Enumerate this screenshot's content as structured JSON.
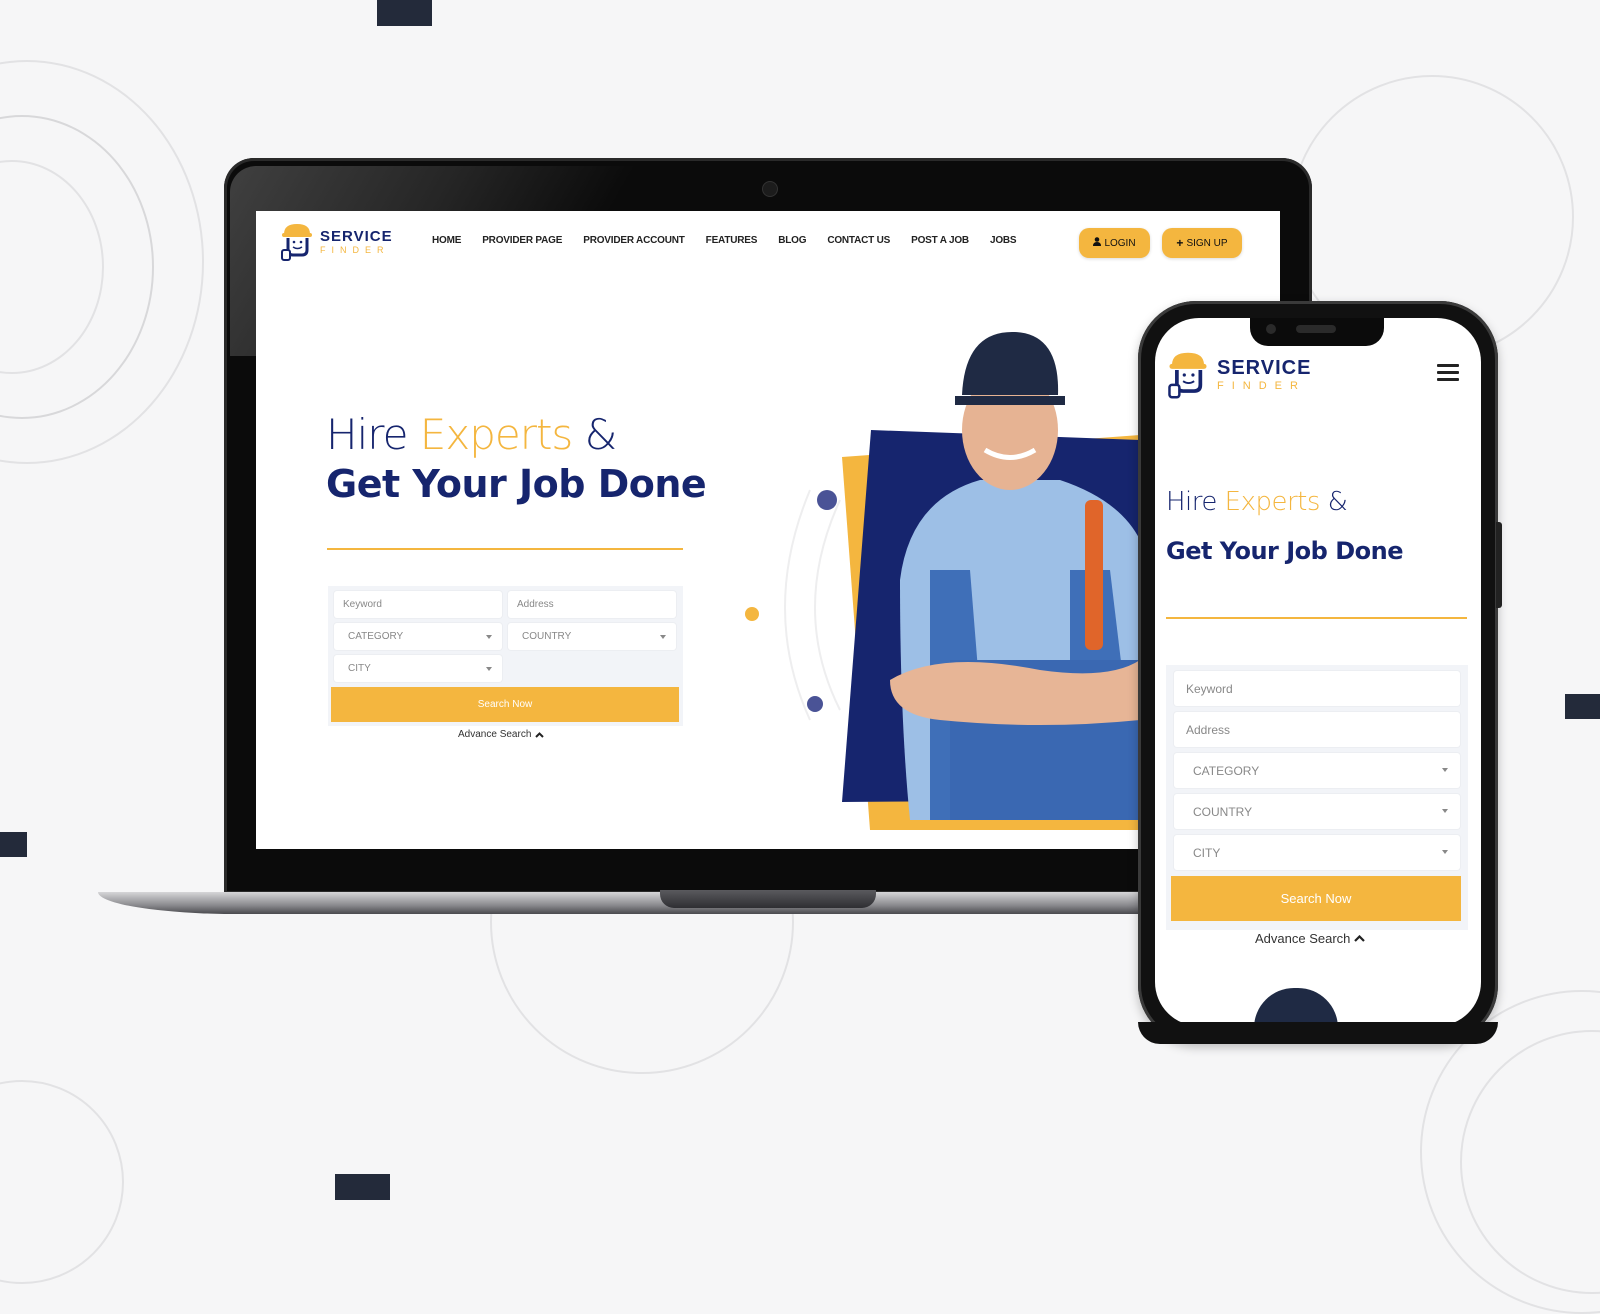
{
  "brand": {
    "name_line1": "SERVICE",
    "name_line2": "FINDER",
    "colors": {
      "navy": "#16256e",
      "yellow": "#f4b63f",
      "dark": "#232a3a"
    }
  },
  "desktop": {
    "nav": [
      "HOME",
      "PROVIDER PAGE",
      "PROVIDER ACCOUNT",
      "FEATURES",
      "BLOG",
      "CONTACT US",
      "POST A JOB",
      "JOBS"
    ],
    "login_label": "LOGIN",
    "signup_label": "SIGN UP",
    "hero": {
      "line1_part1": "Hire",
      "line1_accent": "Experts",
      "line1_part2": "&",
      "line2": "Get Your Job Done"
    },
    "form": {
      "keyword_placeholder": "Keyword",
      "address_placeholder": "Address",
      "category": "CATEGORY",
      "country": "COUNTRY",
      "city": "CITY",
      "search_button": "Search Now",
      "advance_search": "Advance Search"
    }
  },
  "mobile": {
    "hero": {
      "line1_part1": "Hire",
      "line1_accent": "Experts",
      "line1_part2": "&",
      "line2": "Get Your Job Done"
    },
    "form": {
      "keyword_placeholder": "Keyword",
      "address_placeholder": "Address",
      "category": "CATEGORY",
      "country": "COUNTRY",
      "city": "CITY",
      "search_button": "Search Now",
      "advance_search": "Advance Search"
    }
  },
  "icons": {
    "user": "user-icon",
    "plus": "plus-icon",
    "menu": "hamburger-menu-icon",
    "chevron_up": "chevron-up-icon",
    "caret_down": "caret-down-icon"
  }
}
